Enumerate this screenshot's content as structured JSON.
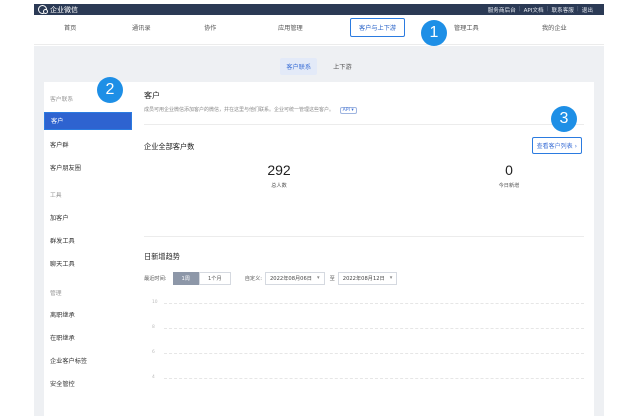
{
  "topbar": {
    "app_name": "企业微信",
    "links": [
      "服务商后台",
      "API文档",
      "联系客服",
      "退出"
    ]
  },
  "mainnav": {
    "items": [
      {
        "label": "首页"
      },
      {
        "label": "通讯录"
      },
      {
        "label": "协作"
      },
      {
        "label": "应用管理"
      },
      {
        "label": "客户与上下游"
      },
      {
        "label": "管理工具"
      },
      {
        "label": "我的企业"
      }
    ],
    "active_index": 4
  },
  "badges": [
    "1",
    "2",
    "3"
  ],
  "subtabs": [
    {
      "label": "客户联系"
    },
    {
      "label": "上下游"
    }
  ],
  "sidebar": {
    "groups": [
      {
        "title": "客户联系",
        "items": [
          "客户",
          "客户群",
          "客户朋友圈"
        ]
      },
      {
        "title": "工具",
        "items": [
          "加客户",
          "群发工具",
          "聊天工具"
        ]
      },
      {
        "title": "管理",
        "items": [
          "离职继承",
          "在职继承",
          "企业客户标签",
          "安全管控"
        ]
      }
    ]
  },
  "main": {
    "title": "客户",
    "description": "成员可用企业微信添加客户的微信，并在这里与他们联系。企业可统一管理这些客户。",
    "api_tag": "API",
    "section_all": "企业全部客户数",
    "view_list": "查看客户列表",
    "stats": [
      {
        "value": "292",
        "label": "总人数"
      },
      {
        "value": "0",
        "label": "今日新增"
      }
    ],
    "trend_title": "日新增趋势",
    "filter": {
      "recent_label": "最近时间:",
      "week": "1周",
      "month": "1个月",
      "custom_label": "自定义:",
      "from": "2022年08月06日",
      "to_label": "至",
      "to": "2022年08月12日"
    },
    "y_ticks": [
      "10",
      "8",
      "6",
      "4"
    ]
  },
  "colors": {
    "topbar": "#2b3a55",
    "accent": "#2b7be0",
    "badge": "#1e8fe6",
    "active_sidebar": "#2e63d0"
  }
}
